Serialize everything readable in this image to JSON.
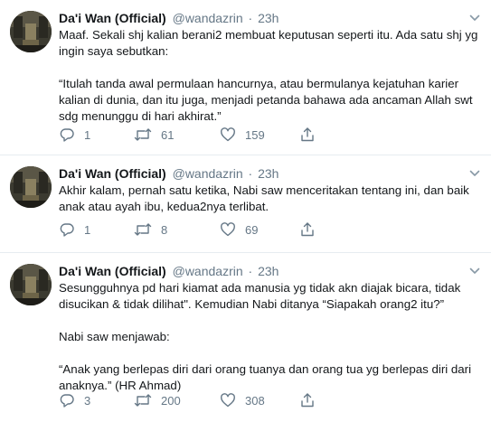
{
  "tweets": [
    {
      "name": "Da'i Wan (Official)",
      "handle": "@wandazrin",
      "separator": "·",
      "time": "23h",
      "paragraphs": [
        "Maaf. Sekali shj kalian berani2 membuat keputusan seperti itu. Ada satu shj yg ingin saya sebutkan:",
        "“Itulah tanda awal permulaan hancurnya, atau bermulanya kejatuhan karier kalian di dunia, dan itu juga, menjadi petanda bahawa ada ancaman Allah swt sdg menunggu di hari akhirat.”"
      ],
      "replies": "1",
      "retweets": "61",
      "likes": "159"
    },
    {
      "name": "Da'i Wan (Official)",
      "handle": "@wandazrin",
      "separator": "·",
      "time": "23h",
      "paragraphs": [
        "Akhir kalam, pernah satu ketika, Nabi saw menceritakan tentang ini, dan baik anak atau ayah ibu, kedua2nya terlibat."
      ],
      "replies": "1",
      "retweets": "8",
      "likes": "69"
    },
    {
      "name": "Da'i Wan (Official)",
      "handle": "@wandazrin",
      "separator": "·",
      "time": "23h",
      "paragraphs": [
        "Sesungguhnya pd hari kiamat ada manusia yg tidak akn diajak bicara, tidak disucikan & tidak dilihat\". Kemudian Nabi ditanya “Siapakah orang2 itu?”",
        "Nabi saw menjawab:",
        "“Anak yang berlepas diri dari orang tuanya dan orang tua yg berlepas diri dari anaknya.” (HR Ahmad)"
      ],
      "replies": "3",
      "retweets": "200",
      "likes": "308"
    }
  ],
  "icons": {
    "reply": "reply-icon",
    "retweet": "retweet-icon",
    "like": "heart-icon",
    "share": "share-icon",
    "menu": "chevron-down-icon"
  },
  "colors": {
    "text": "#14171a",
    "secondary": "#657786",
    "divider": "#e6ecf0"
  }
}
